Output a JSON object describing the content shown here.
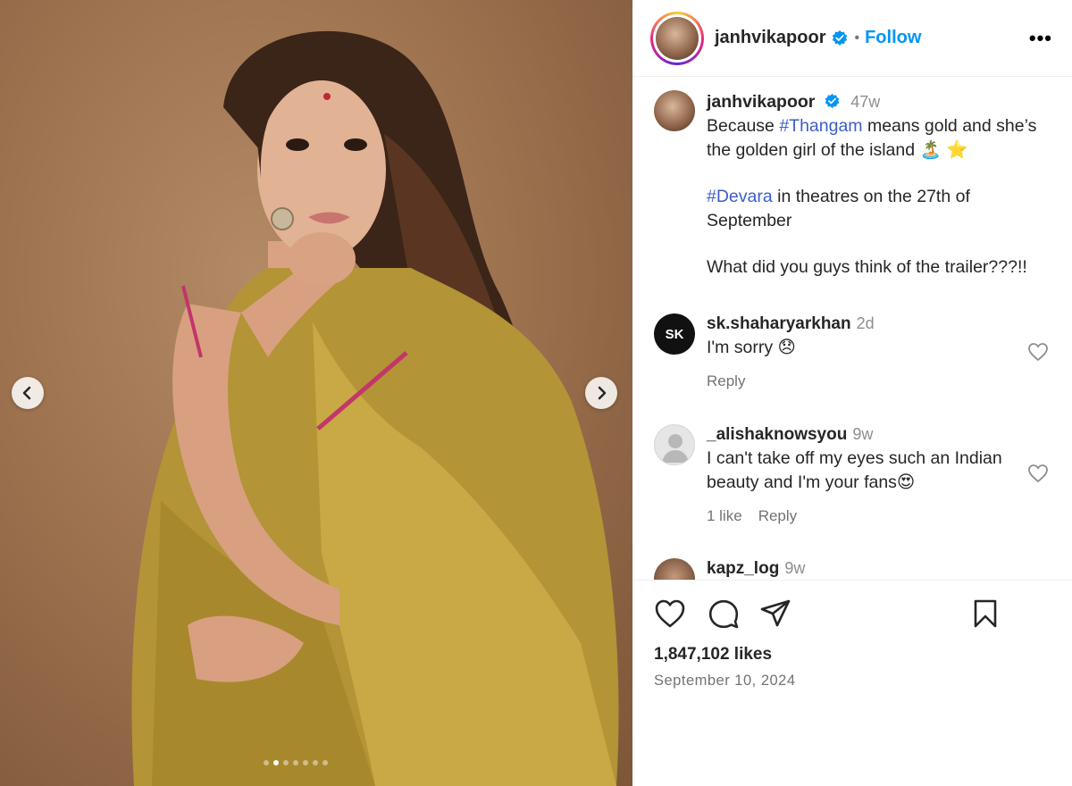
{
  "post": {
    "username": "janhvikapoor",
    "follow_label": "Follow",
    "more_label": "•••",
    "separator": "•",
    "likes_text": "1,847,102 likes",
    "date_text": "September 10, 2024",
    "carousel": {
      "slide_count": 7,
      "active_index": 1
    }
  },
  "caption": {
    "username": "janhvikapoor",
    "time": "47w",
    "line1_pre": "Because ",
    "hashtag1": "#Thangam",
    "line1_post": " means gold and she’s the golden girl of the island 🏝️ ⭐",
    "hashtag2": "#Devara",
    "line2_post": " in theatres on the 27th of September",
    "line3": "What did you guys think of the trailer???!!"
  },
  "comments": [
    {
      "username": "sk.shaharyarkhan",
      "time": "2d",
      "text": "I'm sorry 😞",
      "reply_label": "Reply",
      "avatar_text": "SK"
    },
    {
      "username": "_alishaknowsyou",
      "time": "9w",
      "text": "I can't take off my eyes such an Indian beauty and I'm your fans😍",
      "likes_label": "1 like",
      "reply_label": "Reply"
    },
    {
      "username": "kapz_log",
      "time": "9w"
    }
  ],
  "icons": {
    "like": "heart-icon",
    "comment": "comment-icon",
    "share": "send-icon",
    "save": "bookmark-icon",
    "prev": "chevron-left-icon",
    "next": "chevron-right-icon",
    "verified": "verified-badge-icon"
  },
  "colors": {
    "link": "#0095f6",
    "hashtag": "#3b5ec9",
    "muted": "#737373",
    "verified": "#0095f6"
  }
}
